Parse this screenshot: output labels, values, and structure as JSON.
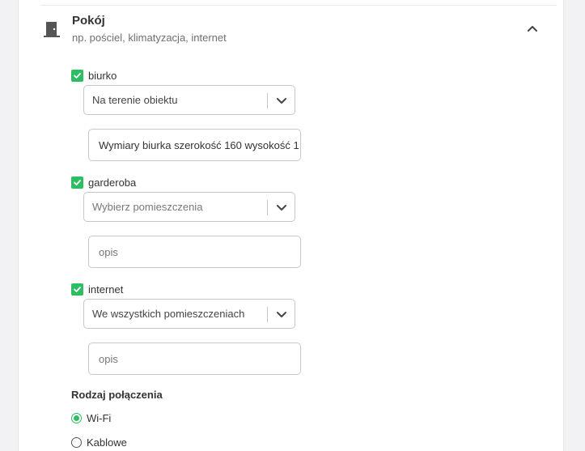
{
  "section": {
    "title": "Pokój",
    "subtitle": "np. pościel, klimatyzacja, internet",
    "icon": "door-icon",
    "collapse_icon": "chevron-up-icon"
  },
  "amenities": [
    {
      "label": "biurko",
      "checked": true,
      "location_value": "Na terenie obiektu",
      "location_is_placeholder": false,
      "description_value": "Wymiary biurka szerokość 160 wysokość 1",
      "description_is_placeholder": false
    },
    {
      "label": "garderoba",
      "checked": true,
      "location_value": "Wybierz pomieszczenia",
      "location_is_placeholder": true,
      "description_value": "opis",
      "description_is_placeholder": true
    },
    {
      "label": "internet",
      "checked": true,
      "location_value": "We wszystkich pomieszczeniach",
      "location_is_placeholder": false,
      "description_value": "opis",
      "description_is_placeholder": true
    }
  ],
  "connection": {
    "title": "Rodzaj połączenia",
    "options": [
      {
        "label": "Wi-Fi",
        "selected": true
      },
      {
        "label": "Kablowe",
        "selected": false
      }
    ]
  },
  "colors": {
    "accent": "#2dbd62",
    "border": "#c8c8cc",
    "text": "#333333",
    "muted": "#6f6f6f"
  }
}
